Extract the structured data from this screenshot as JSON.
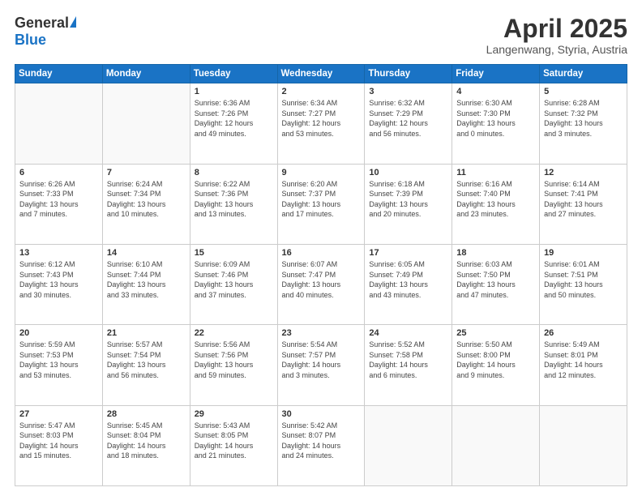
{
  "header": {
    "logo_general": "General",
    "logo_blue": "Blue",
    "month_title": "April 2025",
    "location": "Langenwang, Styria, Austria"
  },
  "weekdays": [
    "Sunday",
    "Monday",
    "Tuesday",
    "Wednesday",
    "Thursday",
    "Friday",
    "Saturday"
  ],
  "weeks": [
    [
      {
        "day": "",
        "detail": ""
      },
      {
        "day": "",
        "detail": ""
      },
      {
        "day": "1",
        "detail": "Sunrise: 6:36 AM\nSunset: 7:26 PM\nDaylight: 12 hours\nand 49 minutes."
      },
      {
        "day": "2",
        "detail": "Sunrise: 6:34 AM\nSunset: 7:27 PM\nDaylight: 12 hours\nand 53 minutes."
      },
      {
        "day": "3",
        "detail": "Sunrise: 6:32 AM\nSunset: 7:29 PM\nDaylight: 12 hours\nand 56 minutes."
      },
      {
        "day": "4",
        "detail": "Sunrise: 6:30 AM\nSunset: 7:30 PM\nDaylight: 13 hours\nand 0 minutes."
      },
      {
        "day": "5",
        "detail": "Sunrise: 6:28 AM\nSunset: 7:32 PM\nDaylight: 13 hours\nand 3 minutes."
      }
    ],
    [
      {
        "day": "6",
        "detail": "Sunrise: 6:26 AM\nSunset: 7:33 PM\nDaylight: 13 hours\nand 7 minutes."
      },
      {
        "day": "7",
        "detail": "Sunrise: 6:24 AM\nSunset: 7:34 PM\nDaylight: 13 hours\nand 10 minutes."
      },
      {
        "day": "8",
        "detail": "Sunrise: 6:22 AM\nSunset: 7:36 PM\nDaylight: 13 hours\nand 13 minutes."
      },
      {
        "day": "9",
        "detail": "Sunrise: 6:20 AM\nSunset: 7:37 PM\nDaylight: 13 hours\nand 17 minutes."
      },
      {
        "day": "10",
        "detail": "Sunrise: 6:18 AM\nSunset: 7:39 PM\nDaylight: 13 hours\nand 20 minutes."
      },
      {
        "day": "11",
        "detail": "Sunrise: 6:16 AM\nSunset: 7:40 PM\nDaylight: 13 hours\nand 23 minutes."
      },
      {
        "day": "12",
        "detail": "Sunrise: 6:14 AM\nSunset: 7:41 PM\nDaylight: 13 hours\nand 27 minutes."
      }
    ],
    [
      {
        "day": "13",
        "detail": "Sunrise: 6:12 AM\nSunset: 7:43 PM\nDaylight: 13 hours\nand 30 minutes."
      },
      {
        "day": "14",
        "detail": "Sunrise: 6:10 AM\nSunset: 7:44 PM\nDaylight: 13 hours\nand 33 minutes."
      },
      {
        "day": "15",
        "detail": "Sunrise: 6:09 AM\nSunset: 7:46 PM\nDaylight: 13 hours\nand 37 minutes."
      },
      {
        "day": "16",
        "detail": "Sunrise: 6:07 AM\nSunset: 7:47 PM\nDaylight: 13 hours\nand 40 minutes."
      },
      {
        "day": "17",
        "detail": "Sunrise: 6:05 AM\nSunset: 7:49 PM\nDaylight: 13 hours\nand 43 minutes."
      },
      {
        "day": "18",
        "detail": "Sunrise: 6:03 AM\nSunset: 7:50 PM\nDaylight: 13 hours\nand 47 minutes."
      },
      {
        "day": "19",
        "detail": "Sunrise: 6:01 AM\nSunset: 7:51 PM\nDaylight: 13 hours\nand 50 minutes."
      }
    ],
    [
      {
        "day": "20",
        "detail": "Sunrise: 5:59 AM\nSunset: 7:53 PM\nDaylight: 13 hours\nand 53 minutes."
      },
      {
        "day": "21",
        "detail": "Sunrise: 5:57 AM\nSunset: 7:54 PM\nDaylight: 13 hours\nand 56 minutes."
      },
      {
        "day": "22",
        "detail": "Sunrise: 5:56 AM\nSunset: 7:56 PM\nDaylight: 13 hours\nand 59 minutes."
      },
      {
        "day": "23",
        "detail": "Sunrise: 5:54 AM\nSunset: 7:57 PM\nDaylight: 14 hours\nand 3 minutes."
      },
      {
        "day": "24",
        "detail": "Sunrise: 5:52 AM\nSunset: 7:58 PM\nDaylight: 14 hours\nand 6 minutes."
      },
      {
        "day": "25",
        "detail": "Sunrise: 5:50 AM\nSunset: 8:00 PM\nDaylight: 14 hours\nand 9 minutes."
      },
      {
        "day": "26",
        "detail": "Sunrise: 5:49 AM\nSunset: 8:01 PM\nDaylight: 14 hours\nand 12 minutes."
      }
    ],
    [
      {
        "day": "27",
        "detail": "Sunrise: 5:47 AM\nSunset: 8:03 PM\nDaylight: 14 hours\nand 15 minutes."
      },
      {
        "day": "28",
        "detail": "Sunrise: 5:45 AM\nSunset: 8:04 PM\nDaylight: 14 hours\nand 18 minutes."
      },
      {
        "day": "29",
        "detail": "Sunrise: 5:43 AM\nSunset: 8:05 PM\nDaylight: 14 hours\nand 21 minutes."
      },
      {
        "day": "30",
        "detail": "Sunrise: 5:42 AM\nSunset: 8:07 PM\nDaylight: 14 hours\nand 24 minutes."
      },
      {
        "day": "",
        "detail": ""
      },
      {
        "day": "",
        "detail": ""
      },
      {
        "day": "",
        "detail": ""
      }
    ]
  ]
}
